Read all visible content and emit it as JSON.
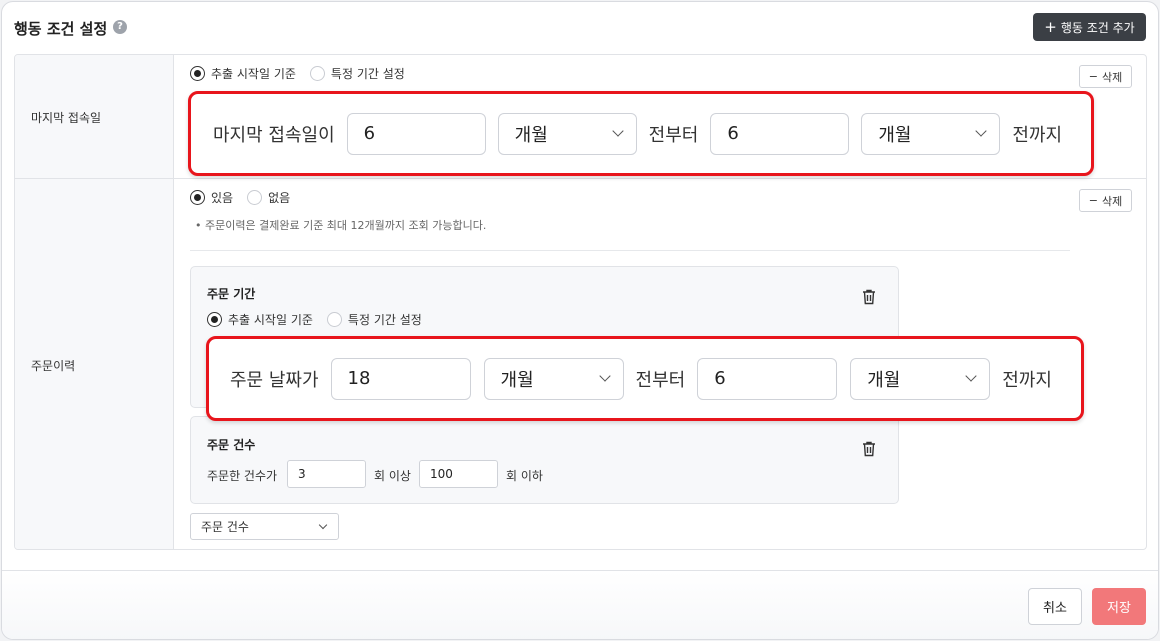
{
  "header": {
    "title": "행동 조건 설정",
    "help_icon": "?",
    "add_button_icon": "+",
    "add_button_label": "행동 조건 추가"
  },
  "rows": {
    "last_access": {
      "label": "마지막 접속일",
      "radios": [
        "추출 시작일 기준",
        "특정 기간 설정"
      ],
      "selected_radio": "추출 시작일 기준",
      "delete_icon": "−",
      "delete_label": "삭제",
      "sentence": {
        "prefix": "마지막 접속일이",
        "from_value": "6",
        "from_unit": "개월",
        "middle": "전부터",
        "to_value": "6",
        "to_unit": "개월",
        "suffix": "전까지"
      }
    },
    "order_history": {
      "label": "주문이력",
      "radios": [
        "있음",
        "없음"
      ],
      "selected_radio": "있음",
      "delete_icon": "−",
      "delete_label": "삭제",
      "note": "주문이력은 결제완료 기준 최대 12개월까지 조회 가능합니다.",
      "order_period": {
        "title": "주문 기간",
        "radios": [
          "추출 시작일 기준",
          "특정 기간 설정"
        ],
        "selected_radio": "추출 시작일 기준",
        "sentence": {
          "prefix": "주문 날짜가",
          "from_value": "18",
          "from_unit": "개월",
          "middle": "전부터",
          "to_value": "6",
          "to_unit": "개월",
          "suffix": "전까지"
        }
      },
      "order_count": {
        "title": "주문 건수",
        "prefix": "주문한 건수가",
        "min_value": "3",
        "min_suffix": "회 이상",
        "max_value": "100",
        "max_suffix": "회 이하"
      },
      "add_select_value": "주문 건수"
    }
  },
  "footer": {
    "cancel_label": "취소",
    "save_label": "저장"
  },
  "colors": {
    "highlight_border": "#e8151c",
    "save_button": "#f2787a",
    "add_button": "#3b3f45"
  }
}
